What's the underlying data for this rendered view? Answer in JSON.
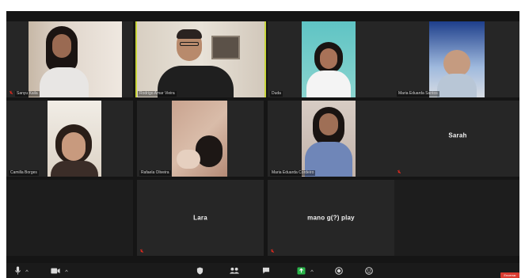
{
  "participants": [
    {
      "name": "Sanyu Kaila",
      "muted": true
    },
    {
      "name": "Rodrigo Amar Vieira",
      "muted": false,
      "active_speaker": true
    },
    {
      "name": "Duda",
      "muted": false
    },
    {
      "name": "Maria Eduarda Santos",
      "muted": false
    },
    {
      "name": "Camilla Borges",
      "muted": false
    },
    {
      "name": "Rafaela Oliveira",
      "muted": false
    },
    {
      "name": "Maria Eduarda Cordeiro",
      "muted": false
    },
    {
      "name": "Sarah",
      "muted": true
    },
    {
      "name": "Lara",
      "muted": true
    },
    {
      "name": "mano g(?) play",
      "muted": true
    }
  ],
  "toolbar": {
    "end_label": "Encerrar"
  },
  "icons": {
    "mute": "mic-off-icon",
    "mic": "mic-icon",
    "video": "video-camera-icon",
    "security": "shield-icon",
    "participants": "people-icon",
    "chat": "chat-bubble-icon",
    "share": "share-screen-icon",
    "record": "record-icon",
    "reactions": "smile-icon"
  },
  "colors": {
    "active_speaker_border": "#c9d63a",
    "mute_red": "#e02a1f",
    "share_green": "#2bb44a",
    "end_red": "#d93b30"
  }
}
